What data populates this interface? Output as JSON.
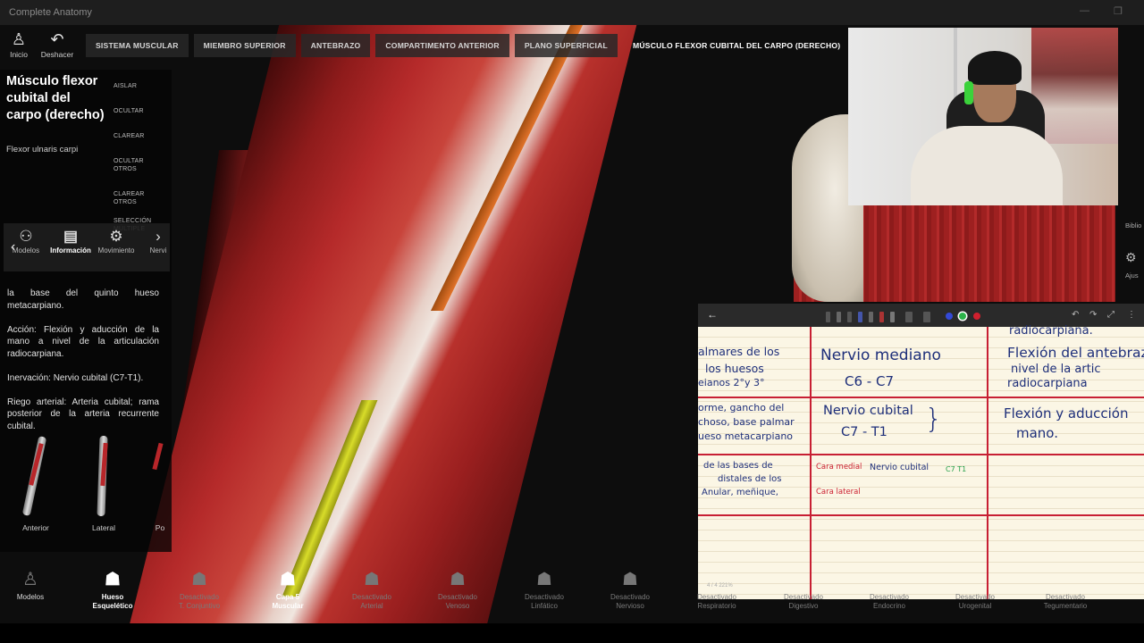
{
  "app": {
    "title": "Complete Anatomy"
  },
  "top_left": {
    "home": "Inicio",
    "undo": "Deshacer"
  },
  "breadcrumb": [
    "SISTEMA MUSCULAR",
    "MIEMBRO SUPERIOR",
    "ANTEBRAZO",
    "COMPARTIMENTO ANTERIOR",
    "PLANO SUPERFICIAL",
    "MÚSCULO FLEXOR CUBITAL DEL CARPO (DERECHO)"
  ],
  "panel": {
    "title": "Músculo flexor cubital del carpo (derecho)",
    "latin": "Flexor ulnaris carpi",
    "actions": [
      "AISLAR",
      "OCULTAR",
      "CLAREAR",
      "OCULTAR OTROS",
      "CLAREAR OTROS",
      "SELECCIÓN MÚLTIPLE"
    ],
    "tabs": [
      "Modelos",
      "Información",
      "Movimiento",
      "Nervi"
    ],
    "info": [
      "la base del quinto hueso metacarpiano.",
      "Acción: Flexión y aducción de la mano a nivel de la articulación radiocarpiana.",
      "Inervación: Nervio cubital (C7-T1).",
      "Riego arterial: Arteria cubital; rama posterior de la arteria recurrente cubital."
    ],
    "views": [
      "Anterior",
      "Lateral",
      "Po"
    ]
  },
  "right_edge": {
    "library": "Biblio",
    "settings": "Ajus"
  },
  "notes": {
    "col1": {
      "row1": [
        "almares de los",
        "los huesos",
        "eianos 2°y 3°"
      ],
      "row2": [
        "orme, gancho del",
        "choso, base palmar",
        "ueso metacarpiano"
      ],
      "row3": [
        "de las bases de",
        "distales de los",
        "Anular, meñique,"
      ]
    },
    "col2": {
      "row1": [
        "Nervio mediano",
        "C6 - C7"
      ],
      "row2": [
        "Nervio cubital",
        "C7 - T1"
      ],
      "row3": [
        "Cara medial",
        "Nervio cubital",
        "C7 T1",
        "Cara lateral"
      ]
    },
    "col3": {
      "row0": "radiocarpiana.",
      "row1": [
        "Flexión del antebrazo",
        "nivel de la artic",
        "radiocarpiana"
      ],
      "row2": [
        "Flexión y aducción",
        "mano."
      ]
    },
    "footer": "4 / 4    221%"
  },
  "bottom": [
    {
      "status": "",
      "name": "Modelos"
    },
    {
      "status": "Hueso",
      "name": "Esquelético"
    },
    {
      "status": "Desactivado",
      "name": "T. Conjuntivo"
    },
    {
      "status": "Capa 5",
      "name": "Muscular"
    },
    {
      "status": "Desactivado",
      "name": "Arterial"
    },
    {
      "status": "Desactivado",
      "name": "Venoso"
    },
    {
      "status": "Desactivado",
      "name": "Linfático"
    },
    {
      "status": "Desactivado",
      "name": "Nervioso"
    },
    {
      "status": "Desactivado",
      "name": "Respiratorio"
    },
    {
      "status": "Desactivado",
      "name": "Digestivo"
    },
    {
      "status": "Desactivado",
      "name": "Endocrino"
    },
    {
      "status": "Desactivado",
      "name": "Urogenital"
    },
    {
      "status": "Desactivado",
      "name": "Tegumentario"
    }
  ],
  "colors": {
    "accent_red": "#c71f33",
    "muscle": "#b52a2a",
    "tendon": "#d8dc2a"
  }
}
